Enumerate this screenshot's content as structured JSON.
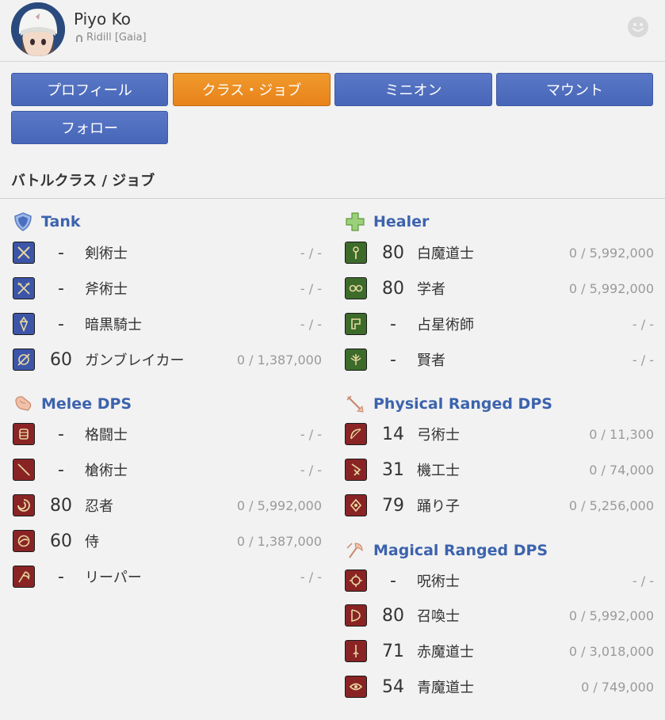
{
  "character": {
    "name": "Piyo Ko",
    "world": "Ridill [Gaia]"
  },
  "tabs": [
    {
      "label": "プロフィール",
      "active": false
    },
    {
      "label": "クラス・ジョブ",
      "active": true
    },
    {
      "label": "ミニオン",
      "active": false
    },
    {
      "label": "マウント",
      "active": false
    },
    {
      "label": "フォロー",
      "active": false
    }
  ],
  "section_title": "バトルクラス / ジョブ",
  "groups": {
    "tank": {
      "name": "Tank",
      "jobs": [
        {
          "level": "-",
          "name": "剣術士",
          "exp": "- / -"
        },
        {
          "level": "-",
          "name": "斧術士",
          "exp": "- / -"
        },
        {
          "level": "-",
          "name": "暗黒騎士",
          "exp": "- / -"
        },
        {
          "level": "60",
          "name": "ガンブレイカー",
          "exp": "0 / 1,387,000"
        }
      ]
    },
    "healer": {
      "name": "Healer",
      "jobs": [
        {
          "level": "80",
          "name": "白魔道士",
          "exp": "0 / 5,992,000"
        },
        {
          "level": "80",
          "name": "学者",
          "exp": "0 / 5,992,000"
        },
        {
          "level": "-",
          "name": "占星術師",
          "exp": "- / -"
        },
        {
          "level": "-",
          "name": "賢者",
          "exp": "- / -"
        }
      ]
    },
    "melee": {
      "name": "Melee DPS",
      "jobs": [
        {
          "level": "-",
          "name": "格闘士",
          "exp": "- / -"
        },
        {
          "level": "-",
          "name": "槍術士",
          "exp": "- / -"
        },
        {
          "level": "80",
          "name": "忍者",
          "exp": "0 / 5,992,000"
        },
        {
          "level": "60",
          "name": "侍",
          "exp": "0 / 1,387,000"
        },
        {
          "level": "-",
          "name": "リーパー",
          "exp": "- / -"
        }
      ]
    },
    "phys_ranged": {
      "name": "Physical Ranged DPS",
      "jobs": [
        {
          "level": "14",
          "name": "弓術士",
          "exp": "0 / 11,300"
        },
        {
          "level": "31",
          "name": "機工士",
          "exp": "0 / 74,000"
        },
        {
          "level": "79",
          "name": "踊り子",
          "exp": "0 / 5,256,000"
        }
      ]
    },
    "mag_ranged": {
      "name": "Magical Ranged DPS",
      "jobs": [
        {
          "level": "-",
          "name": "呪術士",
          "exp": "- / -"
        },
        {
          "level": "80",
          "name": "召喚士",
          "exp": "0 / 5,992,000"
        },
        {
          "level": "71",
          "name": "赤魔道士",
          "exp": "0 / 3,018,000"
        },
        {
          "level": "54",
          "name": "青魔道士",
          "exp": "0 / 749,000"
        }
      ]
    }
  },
  "colors": {
    "tab_blue": "#4766b8",
    "tab_active": "#e8821b",
    "group_title": "#3c63ad"
  }
}
